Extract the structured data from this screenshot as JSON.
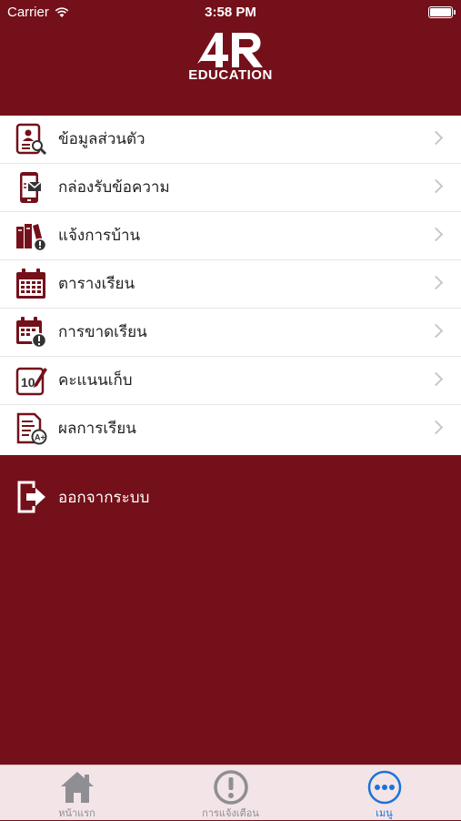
{
  "status_bar": {
    "carrier": "Carrier",
    "time": "3:58 PM"
  },
  "header": {
    "logo_text": "EDUCATION"
  },
  "menu": {
    "items": [
      {
        "label": "ข้อมูลส่วนตัว",
        "icon": "profile-search-icon"
      },
      {
        "label": "กล่องรับข้อความ",
        "icon": "phone-message-icon"
      },
      {
        "label": "แจ้งการบ้าน",
        "icon": "books-alert-icon"
      },
      {
        "label": "ตารางเรียน",
        "icon": "calendar-icon"
      },
      {
        "label": "การขาดเรียน",
        "icon": "calendar-alert-icon"
      },
      {
        "label": "คะแนนเก็บ",
        "icon": "score-edit-icon"
      },
      {
        "label": "ผลการเรียน",
        "icon": "grade-report-icon"
      }
    ]
  },
  "logout": {
    "label": "ออกจากระบบ",
    "icon": "logout-icon"
  },
  "tab_bar": {
    "tabs": [
      {
        "label": "หน้าแรก",
        "icon": "home-icon"
      },
      {
        "label": "การแจ้งเตือน",
        "icon": "alert-icon"
      },
      {
        "label": "เมนู",
        "icon": "more-icon",
        "active": true
      }
    ]
  },
  "colors": {
    "brand": "#74101a",
    "active_tab": "#1a73d9",
    "tab_bar_bg": "#f3e4e7"
  }
}
